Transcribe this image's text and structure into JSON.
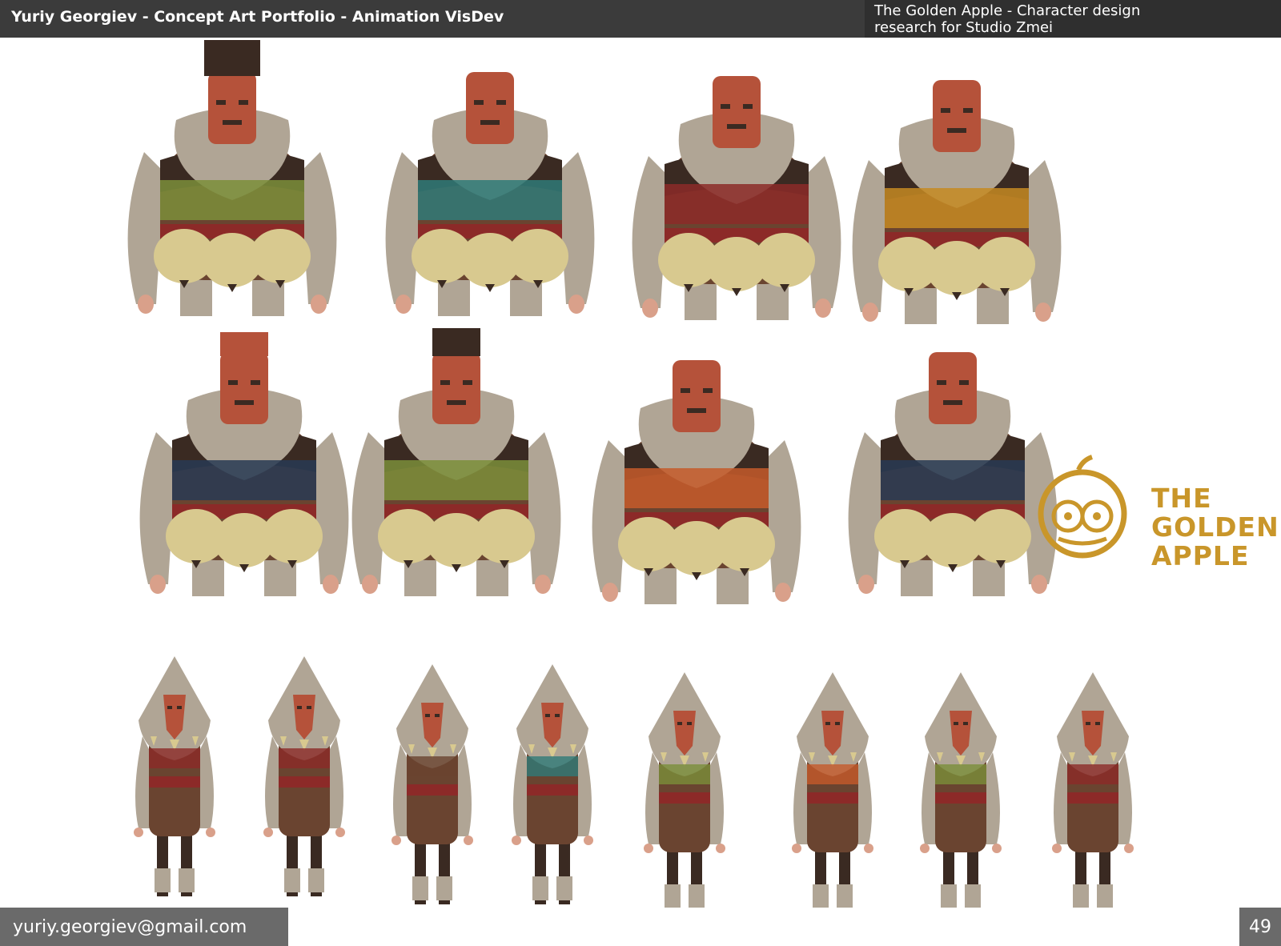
{
  "header": {
    "title": "Yuriy Georgiev - Concept Art Portfolio - Animation VisDev",
    "caption_line1": "The Golden Apple - Character design",
    "caption_line2": "research for Studio Zmei"
  },
  "logo": {
    "line1": "THE",
    "line2": "GOLDEN",
    "line3": "APPLE",
    "color": "#c9962a"
  },
  "footer": {
    "email": "yuriy.georgiev@gmail.com",
    "page_number": "49"
  },
  "colors": {
    "fur": "#b0a595",
    "bell": "#d8c98f",
    "mask": "#b5523a",
    "dark": "#3a2a22",
    "red": "#8c2a28",
    "green": "#7b8e3a",
    "teal": "#2f7a78",
    "navy": "#283a54",
    "skin": "#d9a08a",
    "orange": "#c55a2a",
    "mustard": "#c68a22",
    "brown": "#6a4430"
  }
}
